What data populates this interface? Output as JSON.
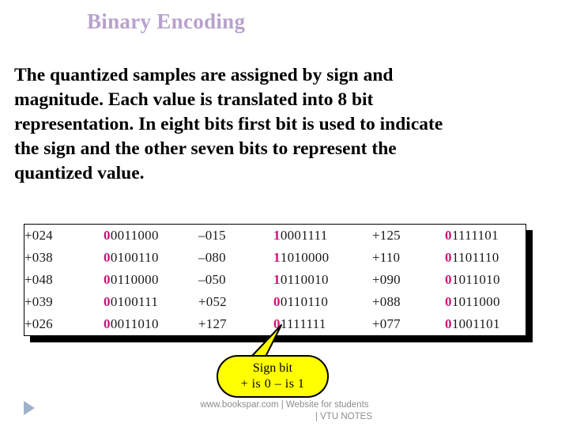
{
  "slide": {
    "title": "Binary Encoding",
    "title_color": "#b8a2cc",
    "body_lines": [
      "The quantized samples are  assigned by sign and",
      "magnitude. Each value is translated  into 8 bit",
      "representation. In eight bits first bit is used to indicate",
      "the sign and the other seven bits to represent the",
      "quantized value."
    ]
  },
  "encoding_table": {
    "sign_bit_color": "#cc1177",
    "rows": [
      {
        "dec1": "+024",
        "bin1_sign": "0",
        "bin1_rest": "0011000",
        "dec2": "–015",
        "bin2_sign": "1",
        "bin2_rest": "0001111",
        "dec3": "+125",
        "bin3_sign": "0",
        "bin3_rest": "1111101"
      },
      {
        "dec1": "+038",
        "bin1_sign": "0",
        "bin1_rest": "0100110",
        "dec2": "–080",
        "bin2_sign": "1",
        "bin2_rest": "1010000",
        "dec3": "+110",
        "bin3_sign": "0",
        "bin3_rest": "1101110"
      },
      {
        "dec1": "+048",
        "bin1_sign": "0",
        "bin1_rest": "0110000",
        "dec2": "–050",
        "bin2_sign": "1",
        "bin2_rest": "0110010",
        "dec3": "+090",
        "bin3_sign": "0",
        "bin3_rest": "1011010"
      },
      {
        "dec1": "+039",
        "bin1_sign": "0",
        "bin1_rest": "0100111",
        "dec2": "+052",
        "bin2_sign": "0",
        "bin2_rest": "0110110",
        "dec3": "+088",
        "bin3_sign": "0",
        "bin3_rest": "1011000"
      },
      {
        "dec1": "+026",
        "bin1_sign": "0",
        "bin1_rest": "0011010",
        "dec2": "+127",
        "bin2_sign": "0",
        "bin2_rest": "1111111",
        "dec3": "+077",
        "bin3_sign": "0",
        "bin3_rest": "1001101"
      }
    ]
  },
  "callout": {
    "line1": "Sign bit",
    "line2": "+ is 0   – is 1",
    "fill_color": "#ffff00"
  },
  "footer": {
    "line1": "www.bookspar.com | Website for students",
    "line2": "| VTU NOTES"
  },
  "nav": {
    "next_icon": "play-triangle-icon"
  }
}
